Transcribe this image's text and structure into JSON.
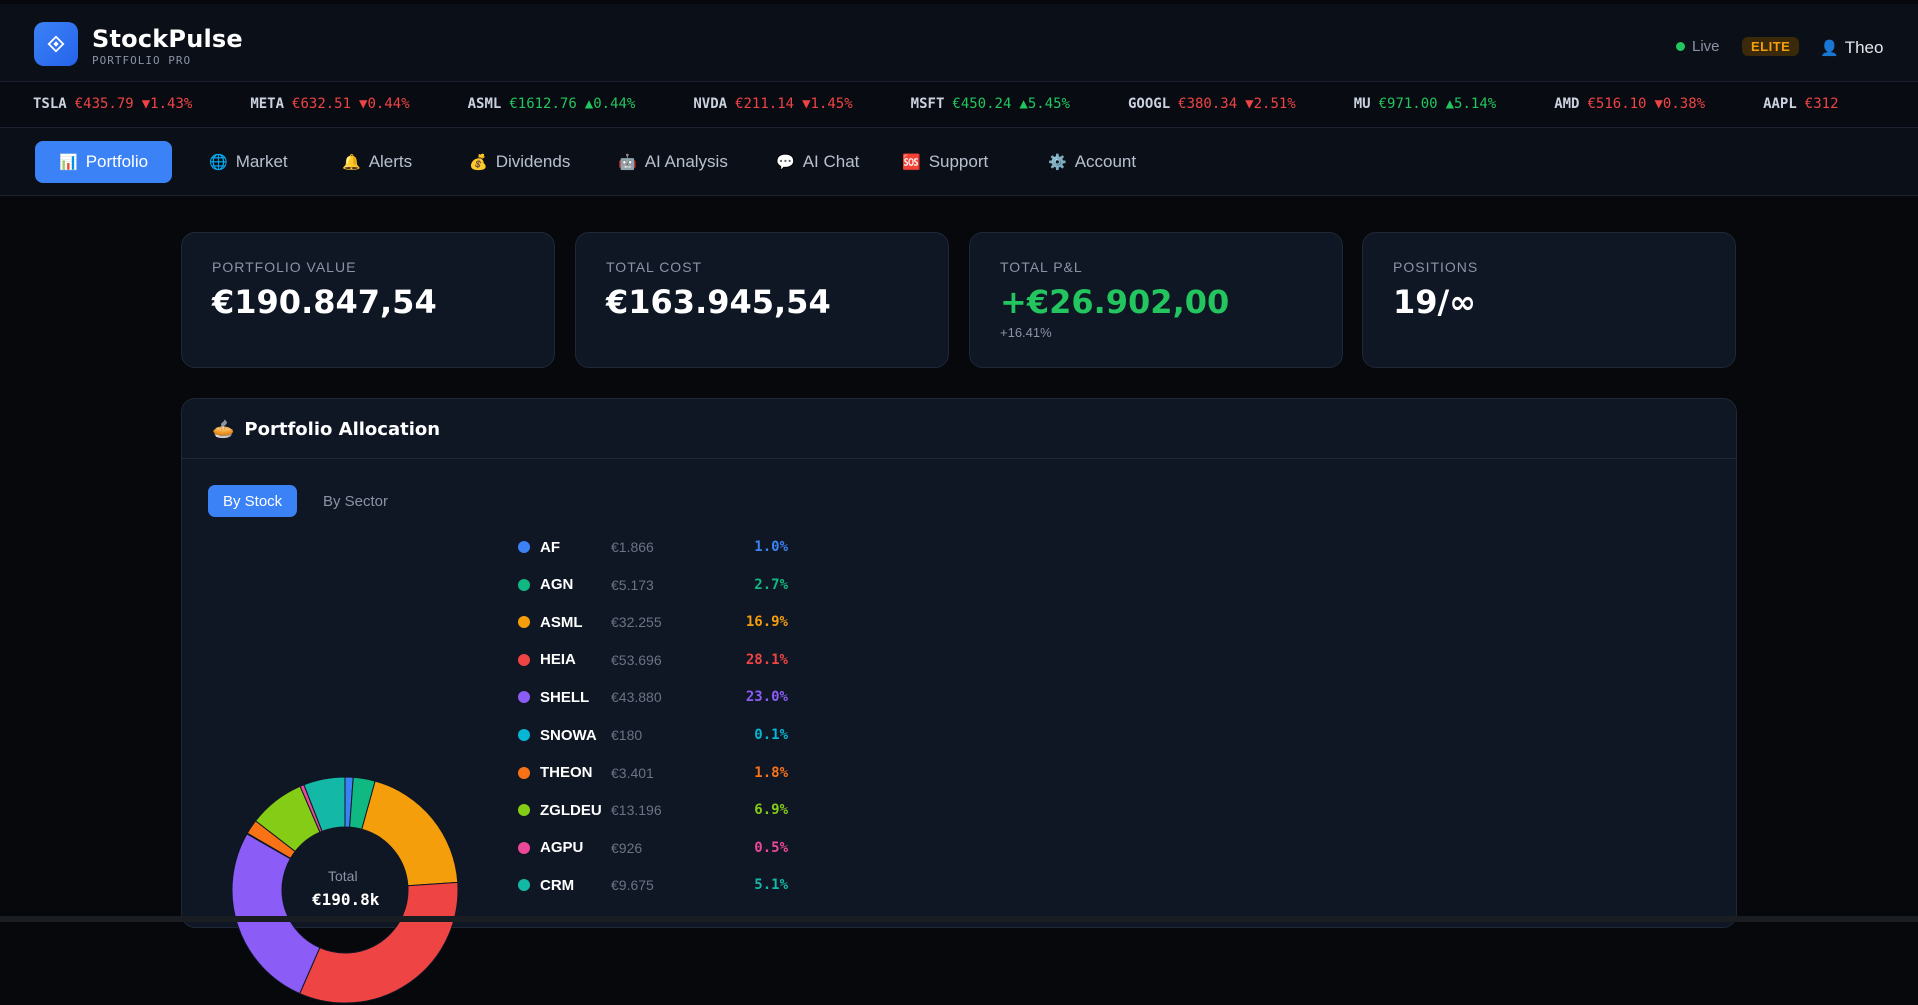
{
  "header": {
    "brand": "StockPulse",
    "subtitle": "PORTFOLIO PRO",
    "live_label": "Live",
    "tier_badge": "ELITE",
    "user_name": "Theo"
  },
  "ticker": [
    {
      "symbol": "TSLA",
      "price": "€435.79",
      "change": "▼1.43%",
      "dir": "down"
    },
    {
      "symbol": "META",
      "price": "€632.51",
      "change": "▼0.44%",
      "dir": "down"
    },
    {
      "symbol": "ASML",
      "price": "€1612.76",
      "change": "▲0.44%",
      "dir": "up"
    },
    {
      "symbol": "NVDA",
      "price": "€211.14",
      "change": "▼1.45%",
      "dir": "down"
    },
    {
      "symbol": "MSFT",
      "price": "€450.24",
      "change": "▲5.45%",
      "dir": "up"
    },
    {
      "symbol": "GOOGL",
      "price": "€380.34",
      "change": "▼2.51%",
      "dir": "down"
    },
    {
      "symbol": "MU",
      "price": "€971.00",
      "change": "▲5.14%",
      "dir": "up"
    },
    {
      "symbol": "AMD",
      "price": "€516.10",
      "change": "▼0.38%",
      "dir": "down"
    },
    {
      "symbol": "AAPL",
      "price": "€312",
      "change": "",
      "dir": "down"
    }
  ],
  "nav": [
    {
      "label": "Portfolio",
      "icon": "📊",
      "active": true
    },
    {
      "label": "Market",
      "icon": "🌐",
      "active": false
    },
    {
      "label": "Alerts",
      "icon": "🔔",
      "active": false
    },
    {
      "label": "Dividends",
      "icon": "💰",
      "active": false
    },
    {
      "label": "AI Analysis",
      "icon": "🤖",
      "active": false
    },
    {
      "label": "AI Chat",
      "icon": "💬",
      "active": false
    },
    {
      "label": "Support",
      "icon": "🆘",
      "active": false
    },
    {
      "label": "Account",
      "icon": "⚙️",
      "active": false
    }
  ],
  "stats": [
    {
      "label": "PORTFOLIO VALUE",
      "value": "€190.847,54",
      "sub": ""
    },
    {
      "label": "TOTAL COST",
      "value": "€163.945,54",
      "sub": ""
    },
    {
      "label": "TOTAL P&L",
      "value": "+€26.902,00",
      "sub": "+16.41%"
    },
    {
      "label": "POSITIONS",
      "value": "19/∞",
      "sub": ""
    }
  ],
  "allocation": {
    "title": "Portfolio Allocation",
    "title_icon": "🥧",
    "tabs": [
      "By Stock",
      "By Sector"
    ],
    "donut_label": "Total",
    "donut_total": "€190.8k"
  },
  "chart_data": {
    "type": "pie",
    "categories": [
      "AF",
      "AGN",
      "ASML",
      "HEIA",
      "SHELL",
      "SNOWA",
      "THEON",
      "ZGLDEU",
      "AGPU",
      "CRM"
    ],
    "amounts": [
      "€1.866",
      "€5.173",
      "€32.255",
      "€53.696",
      "€43.880",
      "€180",
      "€3.401",
      "€13.196",
      "€926",
      "€9.675"
    ],
    "values": [
      1.0,
      2.7,
      16.9,
      28.1,
      23.0,
      0.1,
      1.8,
      6.9,
      0.5,
      5.1
    ],
    "labels": [
      "1.0%",
      "2.7%",
      "16.9%",
      "28.1%",
      "23.0%",
      "0.1%",
      "1.8%",
      "6.9%",
      "0.5%",
      "5.1%"
    ],
    "colors": [
      "#3b82f6",
      "#10b981",
      "#f59e0b",
      "#ef4444",
      "#8b5cf6",
      "#06b6d4",
      "#f97316",
      "#84cc16",
      "#ec4899",
      "#14b8a6"
    ]
  }
}
